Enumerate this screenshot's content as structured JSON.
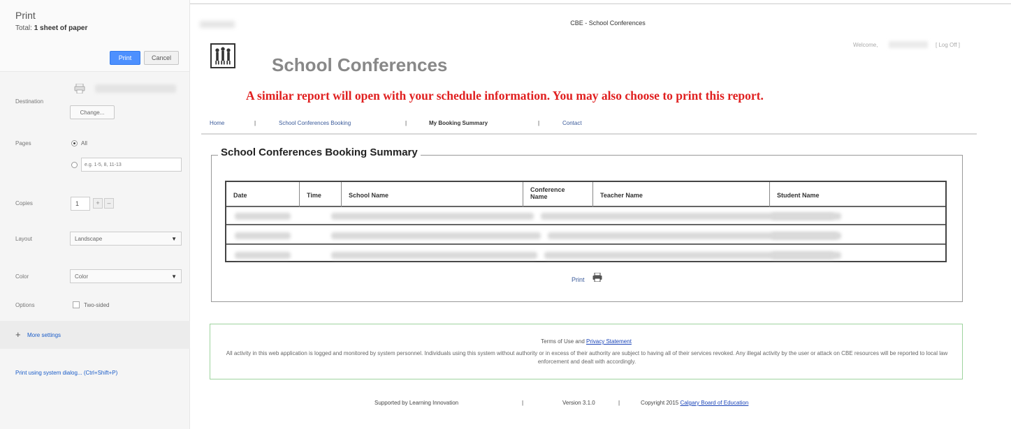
{
  "print_sidebar": {
    "title": "Print",
    "total_prefix": "Total: ",
    "total_value": "1 sheet of paper",
    "print_button": "Print",
    "cancel_button": "Cancel",
    "destination_label": "Destination",
    "change_button": "Change...",
    "pages_label": "Pages",
    "pages_all": "All",
    "pages_placeholder": "e.g. 1-5, 8, 11-13",
    "copies_label": "Copies",
    "copies_value": "1",
    "copies_minus": "–",
    "copies_plus": "+",
    "layout_label": "Layout",
    "layout_value": "Landscape",
    "color_label": "Color",
    "color_value": "Color",
    "options_label": "Options",
    "two_sided": "Two-sided",
    "more_settings": "More settings",
    "system_dialog": "Print using system dialog... (Ctrl+Shift+P)"
  },
  "page": {
    "window_title": "CBE - School Conferences",
    "app_title": "School Conferences",
    "welcome": "Welcome,",
    "logoff": "[ Log Off ]",
    "notice": "A similar report will open with your schedule information.  You may also choose to print this report.",
    "nav": {
      "home": "Home",
      "booking": "School Conferences Booking",
      "summary": "My Booking Summary",
      "contact": "Contact",
      "sep": "|"
    },
    "section_title": "School Conferences Booking Summary",
    "table": {
      "headers": [
        "Date",
        "Time",
        "School Name",
        "Conference Name",
        "Teacher Name",
        "Student Name"
      ]
    },
    "print_link": "Print",
    "terms": {
      "prefix": "Terms of Use and ",
      "privacy": "Privacy Statement",
      "body": "All activity in this web application is logged and monitored by system personnel. Individuals using this system without authority or in excess of their authority are subject to having all of their services revoked. Any illegal activity by the user or attack on CBE resources will be reported to local law enforcement and dealt with accordingly."
    },
    "footer": {
      "supported": "Supported by Learning Innovation",
      "sep": "|",
      "version": "Version 3.1.0",
      "copyright_prefix": "Copyright 2015 ",
      "copyright_link": "Calgary Board of Education"
    }
  }
}
